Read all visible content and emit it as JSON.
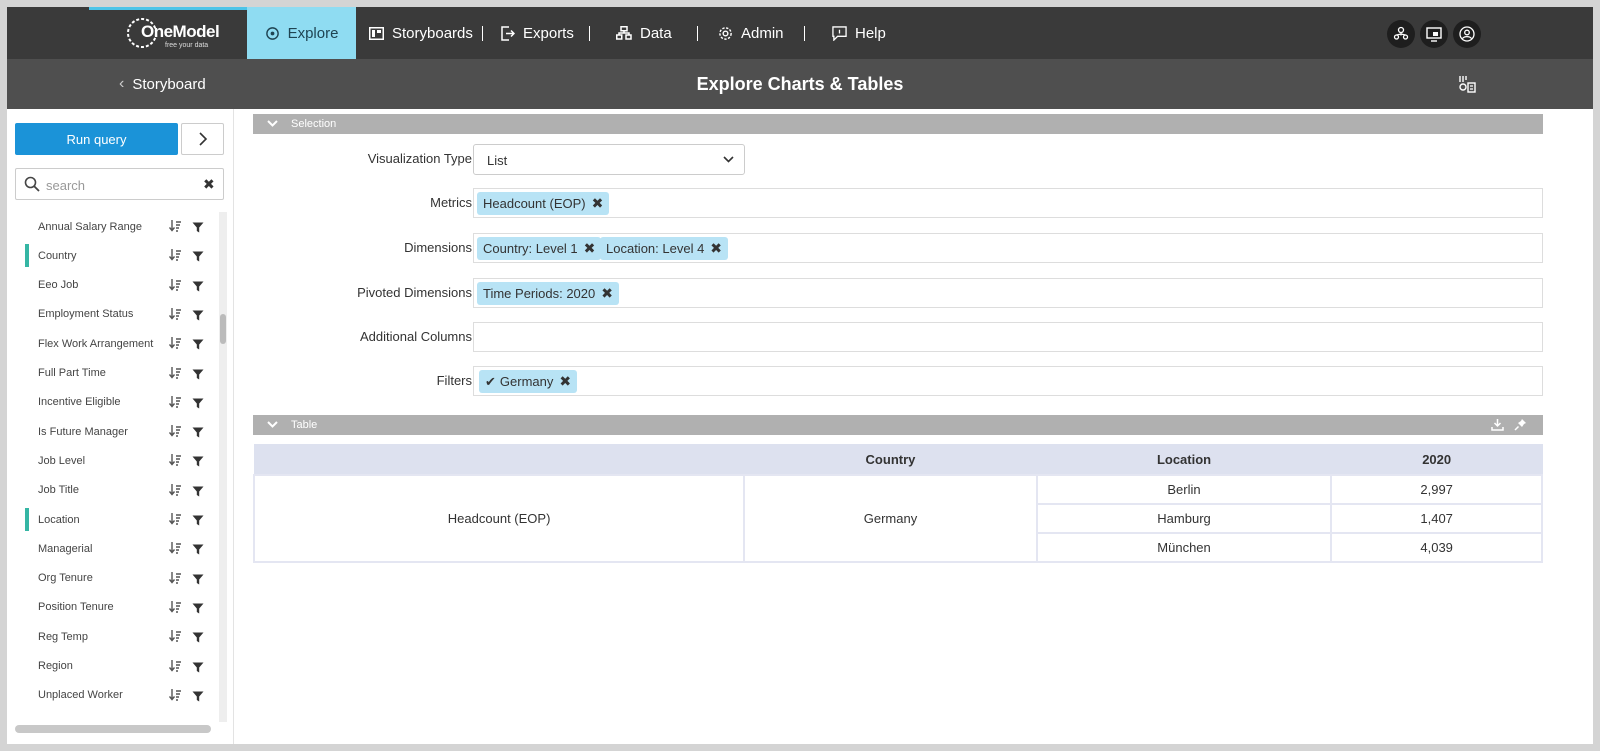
{
  "brand": {
    "name": "OneModel",
    "tagline": "free your data"
  },
  "nav": {
    "items": [
      {
        "label": "Explore",
        "icon": "explore-icon",
        "active": true
      },
      {
        "label": "Storyboards",
        "icon": "storyboards-icon"
      },
      {
        "label": "Exports",
        "icon": "exports-icon"
      },
      {
        "label": "Data",
        "icon": "data-icon"
      },
      {
        "label": "Admin",
        "icon": "gear-icon"
      },
      {
        "label": "Help",
        "icon": "help-icon"
      }
    ],
    "right_icons": [
      "org-chart-icon",
      "desktop-icon",
      "user-icon"
    ]
  },
  "subbar": {
    "back_label": "Storyboard",
    "title": "Explore Charts & Tables"
  },
  "left": {
    "run_label": "Run query",
    "search_placeholder": "search",
    "dimensions": [
      {
        "label": "Annual Salary Range",
        "selected": false
      },
      {
        "label": "Country",
        "selected": true
      },
      {
        "label": "Eeo Job",
        "selected": false
      },
      {
        "label": "Employment Status",
        "selected": false
      },
      {
        "label": "Flex Work Arrangement",
        "selected": false
      },
      {
        "label": "Full Part Time",
        "selected": false
      },
      {
        "label": "Incentive Eligible",
        "selected": false
      },
      {
        "label": "Is Future Manager",
        "selected": false
      },
      {
        "label": "Job Level",
        "selected": false
      },
      {
        "label": "Job Title",
        "selected": false
      },
      {
        "label": "Location",
        "selected": true
      },
      {
        "label": "Managerial",
        "selected": false
      },
      {
        "label": "Org Tenure",
        "selected": false
      },
      {
        "label": "Position Tenure",
        "selected": false
      },
      {
        "label": "Reg Temp",
        "selected": false
      },
      {
        "label": "Region",
        "selected": false
      },
      {
        "label": "Unplaced Worker",
        "selected": false
      }
    ]
  },
  "selection": {
    "header": "Selection",
    "viz_label": "Visualization Type",
    "viz_value": "List",
    "metrics_label": "Metrics",
    "metrics": [
      "Headcount (EOP)"
    ],
    "dimensions_label": "Dimensions",
    "dimensions": [
      "Country: Level 1",
      "Location: Level 4"
    ],
    "pivoted_label": "Pivoted Dimensions",
    "pivoted": [
      "Time Periods: 2020"
    ],
    "additional_label": "Additional Columns",
    "filters_label": "Filters",
    "filters": [
      "Germany"
    ]
  },
  "table": {
    "header": "Table",
    "columns": [
      "",
      "Country",
      "Location",
      "2020"
    ],
    "metric": "Headcount (EOP)",
    "country": "Germany",
    "rows": [
      {
        "location": "Berlin",
        "value": "2,997"
      },
      {
        "location": "Hamburg",
        "value": "1,407"
      },
      {
        "location": "München",
        "value": "4,039"
      }
    ]
  },
  "colors": {
    "nav_bg": "#3a3a3a",
    "active_tab": "#8fdcf2",
    "run_button": "#1b93d8",
    "chip": "#b8e3f5",
    "selected_bar": "#35b6a4"
  }
}
